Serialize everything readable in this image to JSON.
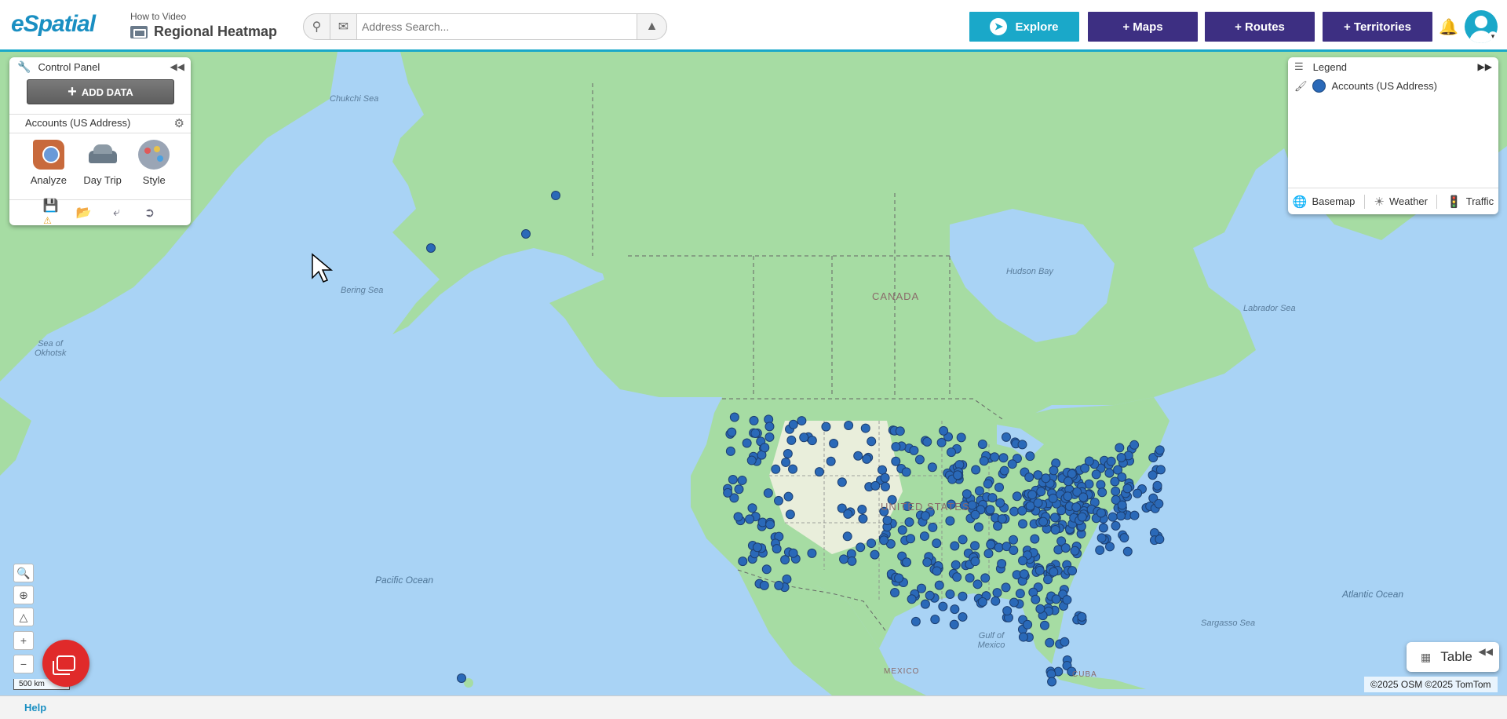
{
  "app": {
    "logo": "eSpatial",
    "subtitle": "How to Video",
    "map_title": "Regional Heatmap"
  },
  "search": {
    "placeholder": "Address Search..."
  },
  "nav": {
    "explore": "Explore",
    "maps": "+ Maps",
    "routes": "+ Routes",
    "territories": "+ Territories"
  },
  "control_panel": {
    "title": "Control Panel",
    "add_data": "ADD DATA",
    "layer_name": "Accounts (US Address)",
    "tools": [
      "Analyze",
      "Day Trip",
      "Style"
    ]
  },
  "legend": {
    "title": "Legend",
    "item": "Accounts (US Address)",
    "footer": [
      "Basemap",
      "Weather",
      "Traffic"
    ]
  },
  "map_labels": {
    "chukchi": "Chukchi Sea",
    "bering": "Bering Sea",
    "okhotsk": "Sea of Okhotsk",
    "hudson": "Hudson Bay",
    "labrador": "Labrador Sea",
    "canada": "CANADA",
    "us": "UNITED STATES",
    "pacific": "Pacific Ocean",
    "atlantic": "Atlantic Ocean",
    "sargasso": "Sargasso Sea",
    "gulf": "Gulf of Mexico",
    "mexico": "MEXICO",
    "cuba": "CUBA"
  },
  "scale": "500 km",
  "table_button": "Table",
  "attribution": "©2025 OSM  ©2025 TomTom",
  "footer": {
    "help": "Help"
  },
  "colors": {
    "accent": "#1aa8c9",
    "nav_purple": "#3d2f82",
    "marker": "#2a69b8",
    "water": "#a9d3f5",
    "land": "#a6dca3"
  }
}
